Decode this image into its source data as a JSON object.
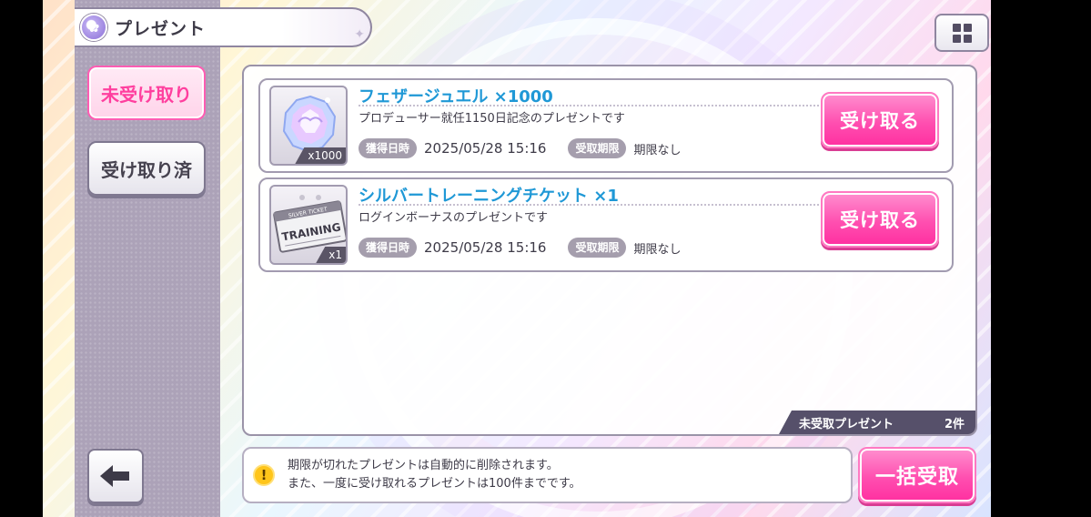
{
  "header": {
    "title": "プレゼント",
    "icon": "present-badge-icon",
    "menu_icon": "grid-menu-icon"
  },
  "tabs": [
    {
      "label": "未受け取り",
      "selected": true
    },
    {
      "label": "受け取り済",
      "selected": false
    }
  ],
  "presents": [
    {
      "name": "フェザージュエル ×1000",
      "description": "プロデューサー就任1150日記念のプレゼントです",
      "quantity": "x1000",
      "acquired_label": "獲得日時",
      "acquired_at": "2025/05/28 15:16",
      "deadline_label": "受取期限",
      "deadline": "期限なし",
      "button_label": "受け取る",
      "icon": "feather-jewel-icon"
    },
    {
      "name": "シルバートレーニングチケット ×1",
      "description": "ログインボーナスのプレゼントです",
      "quantity": "x1",
      "acquired_label": "獲得日時",
      "acquired_at": "2025/05/28 15:16",
      "deadline_label": "受取期限",
      "deadline": "期限なし",
      "button_label": "受け取る",
      "icon": "silver-training-ticket-icon",
      "ticket_text": "TRAINING",
      "ticket_header": "SILVER TICKET"
    }
  ],
  "summary": {
    "label": "未受取プレゼント",
    "count": "2件"
  },
  "notice": {
    "line1": "期限が切れたプレゼントは自動的に削除されます。",
    "line2": "また、一度に受け取れるプレゼントは100件までです。"
  },
  "bulk_button_label": "一括受取",
  "colors": {
    "accent_pink": "#ff4fb0",
    "item_name_blue": "#1f98d6",
    "sidebar": "#aca2b8"
  }
}
